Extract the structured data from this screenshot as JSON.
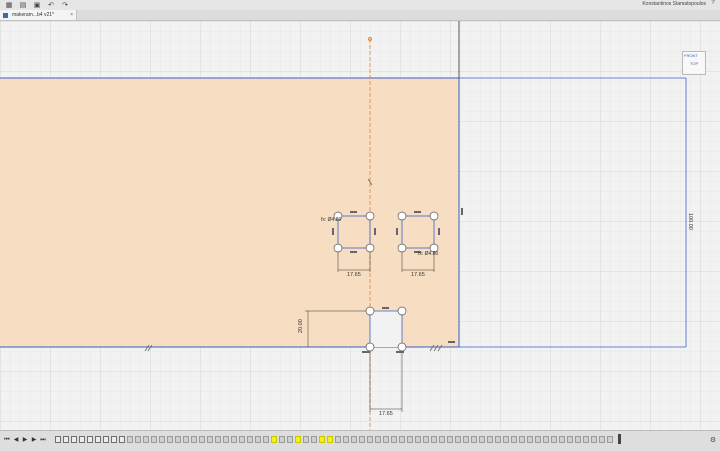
{
  "topbar": {
    "grid_icon": "grid-icon",
    "file_icon": "file-icon",
    "save_icon": "save-icon",
    "undo_icon": "undo-icon",
    "redo_icon": "redo-icon",
    "user_name": "Konstantinos Stamatopoulos",
    "help_icon": "help-icon"
  },
  "tab": {
    "title": "makeram...b4 v21*",
    "close": "×"
  },
  "viewcube": {
    "label": "FRONT",
    "label2": "TOP"
  },
  "sketch": {
    "dim_height_right": "100.00",
    "dim_bottom_width": "17.65",
    "dim_left_square_width": "17.65",
    "dim_right_square_width": "17.65",
    "dim_left_vertical": "20.00",
    "dim_dia_left": "fx: Ø4.80",
    "dim_dia_right": "fx: Ø4.80"
  },
  "colors": {
    "face_fill": "#f7dcbe",
    "sketch_line": "#3b5fcf",
    "grid": "#d6d6d6",
    "axis_orange": "#e4832a",
    "highlight": "#f2f21a"
  },
  "timeline": {
    "features_total": 70,
    "highlighted": [
      27,
      30,
      33,
      34
    ],
    "settings_icon": "gear-icon"
  }
}
